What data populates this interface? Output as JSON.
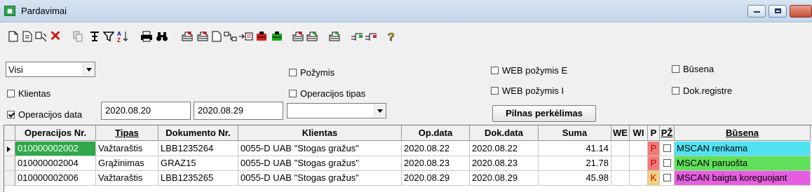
{
  "window": {
    "title": "Pardavimai",
    "app_icon": "grid-app-icon"
  },
  "toolbar": {
    "icons": [
      "new-document-icon",
      "copy-document-icon",
      "find-replace-icon",
      "delete-icon",
      "paste-icon",
      "filter-group-icon",
      "filter-icon",
      "sort-az-icon",
      "print-icon",
      "binoculars-icon",
      "import-icon",
      "import2-icon",
      "document-icon",
      "link-icon",
      "export-icon",
      "tree-icon",
      "tree2-icon",
      "tree3-icon",
      "tree4-icon",
      "tree5-icon",
      "tree6-icon",
      "tree7-icon",
      "help-icon"
    ]
  },
  "filters": {
    "scope_combo": "Visi",
    "klientas_label": "Klientas",
    "operacijos_data_label": "Operacijos data",
    "date_from": "2020.08.20",
    "date_to": "2020.08.29",
    "date_combo": "",
    "pozymis_label": "Požymis",
    "operacijos_tipas_label": "Operacijos tipas",
    "web_pozymis_e_label": "WEB požymis E",
    "web_pozymis_i_label": "WEB požymis I",
    "busena_label": "Būsena",
    "dok_registre_label": "Dok.registre",
    "pilnas_perkelimas": "Pilnas perkėlimas"
  },
  "table": {
    "headers": [
      "Operacijos Nr.",
      "Tipas",
      "Dokumento Nr.",
      "Klientas",
      "Op.data",
      "Dok.data",
      "Suma",
      "WE",
      "WI",
      "P",
      "PŽ",
      "Būsena"
    ],
    "rows": [
      {
        "op_nr": "010000002002",
        "tipas": "Važtaraštis",
        "dok_nr": "LBB1235264",
        "klientas": "0055-D  UAB \"Stogas gražus\"",
        "op_data": "2020.08.22",
        "dok_data": "2020.08.22",
        "suma": "41.14",
        "we": "",
        "wi": "",
        "p": "P",
        "busena": "MSCAN renkama",
        "p_color": "#f47a7a",
        "busena_color": "#4fe3f2"
      },
      {
        "op_nr": "010000002004",
        "tipas": "Grąžinimas",
        "dok_nr": "GRAZ15",
        "klientas": "0055-D  UAB \"Stogas gražus\"",
        "op_data": "2020.08.23",
        "dok_data": "2020.08.23",
        "suma": "21.78",
        "we": "",
        "wi": "",
        "p": "P",
        "busena": "MSCAN paruošta",
        "p_color": "#f47a7a",
        "busena_color": "#5fe05a"
      },
      {
        "op_nr": "010000002006",
        "tipas": "Važtaraštis",
        "dok_nr": "LBB1235265",
        "klientas": "0055-D  UAB \"Stogas gražus\"",
        "op_data": "2020.08.29",
        "dok_data": "2020.08.29",
        "suma": "45.98",
        "we": "",
        "wi": "",
        "p": "K",
        "busena": "MSCAN baigta koreguojant",
        "p_color": "#f5cf7a",
        "busena_color": "#e65ee0"
      }
    ],
    "selection_color": "#2fa84a"
  }
}
